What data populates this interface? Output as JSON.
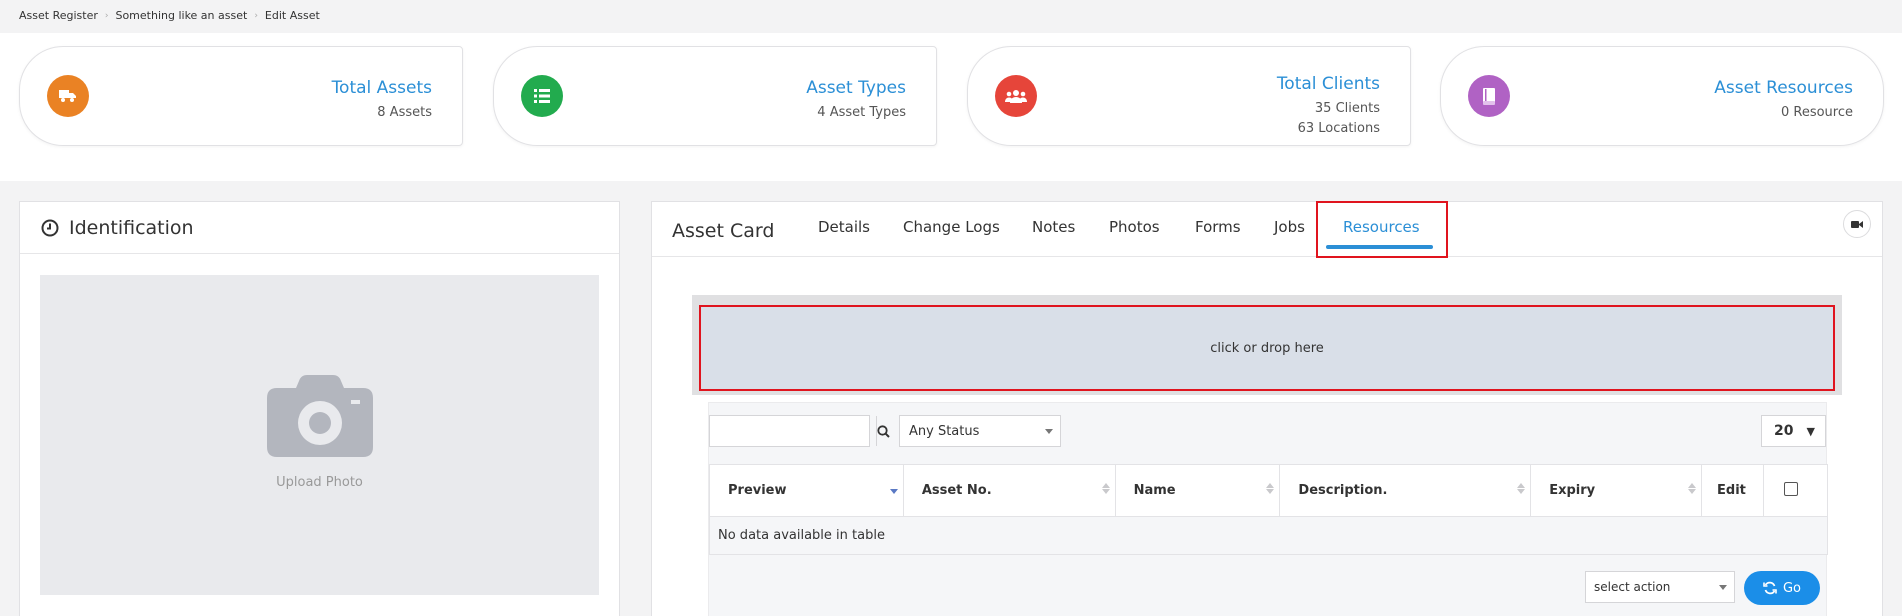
{
  "breadcrumb": [
    "Asset Register",
    "Something like an asset",
    "Edit Asset"
  ],
  "stats": [
    {
      "title": "Total Assets",
      "lines": [
        "8 Assets"
      ],
      "icon": "truck-icon",
      "color": "#ea8224"
    },
    {
      "title": "Asset Types",
      "lines": [
        "4 Asset Types"
      ],
      "icon": "list-icon",
      "color": "#22ab4e"
    },
    {
      "title": "Total Clients",
      "lines": [
        "35 Clients",
        "63 Locations"
      ],
      "icon": "users-icon",
      "color": "#e6453a"
    },
    {
      "title": "Asset Resources",
      "lines": [
        "0 Resource"
      ],
      "icon": "book-icon",
      "color": "#b062c4"
    }
  ],
  "identification": {
    "title": "Identification",
    "upload_label": "Upload Photo"
  },
  "asset_card": {
    "title": "Asset Card",
    "tabs": [
      "Details",
      "Change Logs",
      "Notes",
      "Photos",
      "Forms",
      "Jobs",
      "Resources"
    ],
    "active_tab": "Resources",
    "accent": "#2b8fd6"
  },
  "resources": {
    "drop_text": "click or drop here",
    "search_value": "",
    "status_filter": "Any Status",
    "page_length": "20",
    "columns": [
      "Preview",
      "Asset No.",
      "Name",
      "Description.",
      "Expiry",
      "Edit"
    ],
    "empty_text": "No data available in table",
    "action_placeholder": "select action",
    "go_label": "Go"
  }
}
